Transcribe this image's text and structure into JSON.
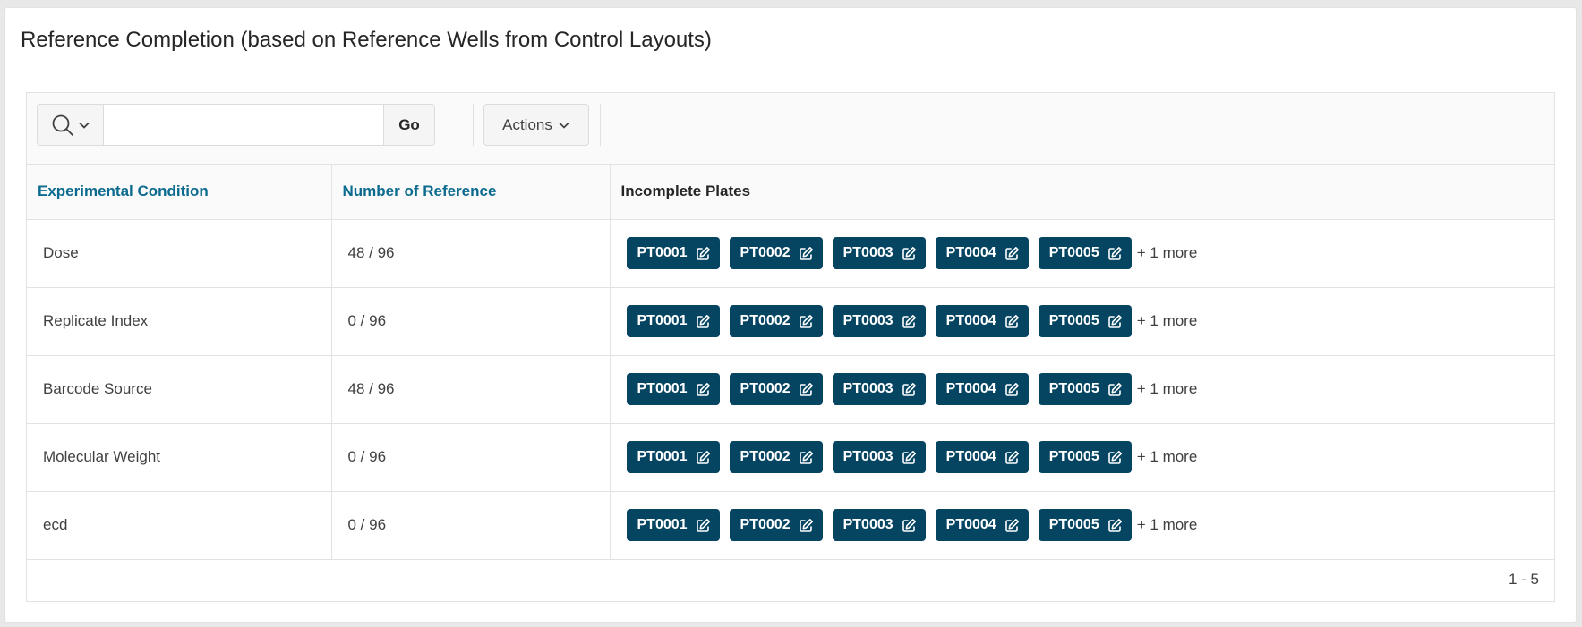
{
  "region": {
    "title": "Reference Completion (based on Reference Wells from Control Layouts)"
  },
  "toolbar": {
    "search_icon": "search-icon",
    "search_value": "",
    "search_placeholder": "",
    "go_label": "Go",
    "actions_label": "Actions"
  },
  "table": {
    "columns": [
      {
        "label": "Experimental Condition",
        "sortable": true
      },
      {
        "label": "Number of Reference",
        "sortable": true
      },
      {
        "label": "Incomplete Plates",
        "sortable": false
      }
    ],
    "rows": [
      {
        "condition": "Dose",
        "reference": "48 / 96",
        "plates": [
          "PT0001",
          "PT0002",
          "PT0003",
          "PT0004",
          "PT0005"
        ],
        "more": "+ 1 more"
      },
      {
        "condition": "Replicate Index",
        "reference": "0 / 96",
        "plates": [
          "PT0001",
          "PT0002",
          "PT0003",
          "PT0004",
          "PT0005"
        ],
        "more": "+ 1 more"
      },
      {
        "condition": "Barcode Source",
        "reference": "48 / 96",
        "plates": [
          "PT0001",
          "PT0002",
          "PT0003",
          "PT0004",
          "PT0005"
        ],
        "more": "+ 1 more"
      },
      {
        "condition": "Molecular Weight",
        "reference": "0 / 96",
        "plates": [
          "PT0001",
          "PT0002",
          "PT0003",
          "PT0004",
          "PT0005"
        ],
        "more": "+ 1 more"
      },
      {
        "condition": "ecd",
        "reference": "0 / 96",
        "plates": [
          "PT0001",
          "PT0002",
          "PT0003",
          "PT0004",
          "PT0005"
        ],
        "more": "+ 1 more"
      }
    ]
  },
  "pagination": {
    "range": "1 - 5"
  },
  "colors": {
    "plate_button_bg": "#054562",
    "sortable_header": "#0b6a8f"
  },
  "icons": {
    "plate_edit": "edit-icon",
    "actions_chevron": "chevron-down-icon"
  }
}
